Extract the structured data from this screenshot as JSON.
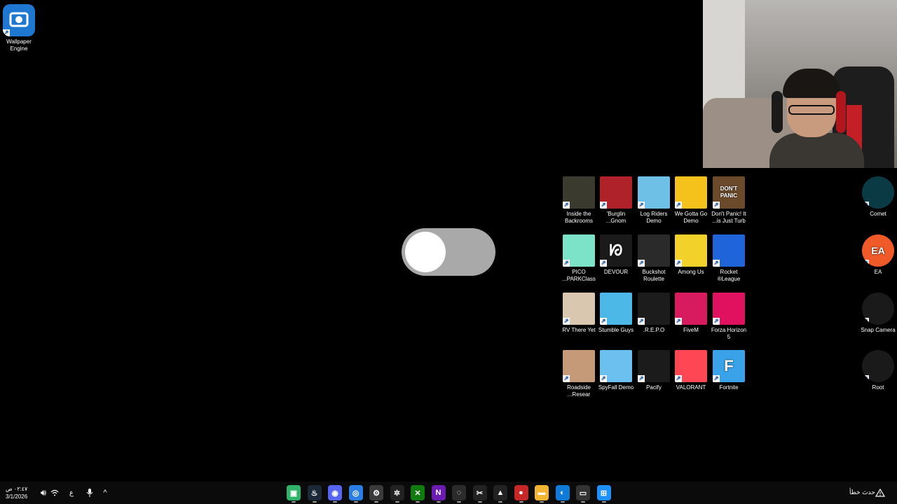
{
  "desktop_left": {
    "wallpaper_engine": {
      "label": "Wallpaper\nEngine",
      "icon": "wallpaper-engine-icon",
      "color": "#1e78d2"
    }
  },
  "games": [
    {
      "label": "Inside the\nBackrooms",
      "icon": "backrooms-icon",
      "color": "#3b3a2e",
      "text": ""
    },
    {
      "label": "'Burglin\n...Gnom",
      "icon": "gnome-icon",
      "color": "#b0222a",
      "text": ""
    },
    {
      "label": "Log Riders\nDemo",
      "icon": "log-riders-icon",
      "color": "#6ec0e6",
      "text": ""
    },
    {
      "label": "We Gotta Go\nDemo",
      "icon": "screaming-face-icon",
      "color": "#f4c21a",
      "text": ""
    },
    {
      "label": "Don't Panic! It\n...is Just Turb",
      "icon": "dont-panic-icon",
      "color": "#6b4a2b",
      "text": "DON'T\nPANIC"
    },
    {
      "label": "PICO\n...PARKClass",
      "icon": "pico-park-icon",
      "color": "#7de3c8",
      "text": ""
    },
    {
      "label": "DEVOUR",
      "icon": "devour-icon",
      "color": "#1a1a1a",
      "text": "ᘗ"
    },
    {
      "label": "Buckshot\nRoulette",
      "icon": "buckshot-icon",
      "color": "#2a2a2a",
      "text": ""
    },
    {
      "label": "Among Us",
      "icon": "among-us-icon",
      "color": "#f2d22a",
      "text": ""
    },
    {
      "label": "Rocket\n®League",
      "icon": "rocket-league-icon",
      "color": "#1f64d8",
      "text": ""
    },
    {
      "label": "RV There Yet",
      "icon": "rv-there-yet-icon",
      "color": "#d9c7b0",
      "text": ""
    },
    {
      "label": "Stumble Guys",
      "icon": "stumble-guys-icon",
      "color": "#4cb8e8",
      "text": ""
    },
    {
      "label": ".R.E.P.O",
      "icon": "repo-icon",
      "color": "#1c1c1c",
      "text": ""
    },
    {
      "label": "FiveM",
      "icon": "fivem-icon",
      "color": "#d81b5f",
      "text": ""
    },
    {
      "label": "Forza Horizon\n5",
      "icon": "forza-icon",
      "color": "#e0115f",
      "text": ""
    },
    {
      "label": "Roadside\n...Resear",
      "icon": "roadside-icon",
      "color": "#c49a78",
      "text": ""
    },
    {
      "label": "SpyFall Demo",
      "icon": "spyfall-icon",
      "color": "#6cc0f0",
      "text": ""
    },
    {
      "label": "Pacify",
      "icon": "pacify-icon",
      "color": "#1b1b1b",
      "text": ""
    },
    {
      "label": "VALORANT",
      "icon": "valorant-icon",
      "color": "#ff4655",
      "text": ""
    },
    {
      "label": "Fortnite",
      "icon": "fortnite-icon",
      "color": "#3aa2e8",
      "text": "F"
    }
  ],
  "right_column": [
    {
      "label": "Comet",
      "icon": "comet-icon",
      "color": "#0a3b45",
      "text": ""
    },
    {
      "label": "EA",
      "icon": "ea-icon",
      "color": "#f05a28",
      "text": "EA"
    },
    {
      "label": "Snap Camera",
      "icon": "snap-camera-icon",
      "color": "#1a1a1a",
      "text": ""
    },
    {
      "label": "Root",
      "icon": "root-icon",
      "color": "#1a1a1a",
      "text": ""
    }
  ],
  "taskbar": {
    "clock_time": "٠٢:٤٧ ص",
    "clock_date": "3/1/2026",
    "lang": "ع",
    "status_text": "حدث خطأ",
    "apps": [
      {
        "name": "taskbar-app-green",
        "icon": "green-app-icon",
        "color": "#2fb36a",
        "glyph": "▣"
      },
      {
        "name": "taskbar-steam",
        "icon": "steam-icon",
        "color": "#1b2838",
        "glyph": "♨"
      },
      {
        "name": "taskbar-discord",
        "icon": "discord-icon",
        "color": "#5865f2",
        "glyph": "◉"
      },
      {
        "name": "taskbar-chrome",
        "icon": "chrome-icon",
        "color": "#2a7de1",
        "glyph": "◎"
      },
      {
        "name": "taskbar-settings",
        "icon": "gear-icon",
        "color": "#3a3a3a",
        "glyph": "⚙"
      },
      {
        "name": "taskbar-steelseries",
        "icon": "steelseries-icon",
        "color": "#222",
        "glyph": "✲"
      },
      {
        "name": "taskbar-xbox",
        "icon": "xbox-icon",
        "color": "#107c10",
        "glyph": "✕"
      },
      {
        "name": "taskbar-nzxt",
        "icon": "nzxt-icon",
        "color": "#6a1bb0",
        "glyph": "N"
      },
      {
        "name": "taskbar-obs",
        "icon": "obs-icon",
        "color": "#2b2b2b",
        "glyph": "◌"
      },
      {
        "name": "taskbar-capcut",
        "icon": "capcut-icon",
        "color": "#222",
        "glyph": "✂"
      },
      {
        "name": "taskbar-app-tent",
        "icon": "tent-icon",
        "color": "#222",
        "glyph": "▲"
      },
      {
        "name": "taskbar-app-red",
        "icon": "red-circle-icon",
        "color": "#c62828",
        "glyph": "●"
      },
      {
        "name": "taskbar-file-explorer",
        "icon": "folder-icon",
        "color": "#f2b531",
        "glyph": "▬"
      },
      {
        "name": "taskbar-edge",
        "icon": "edge-icon",
        "color": "#0f7bd8",
        "glyph": "◐"
      },
      {
        "name": "taskbar-task-view",
        "icon": "task-view-icon",
        "color": "#333",
        "glyph": "▭"
      },
      {
        "name": "taskbar-start",
        "icon": "windows-start-icon",
        "color": "#1e90ff",
        "glyph": "⊞"
      }
    ]
  }
}
